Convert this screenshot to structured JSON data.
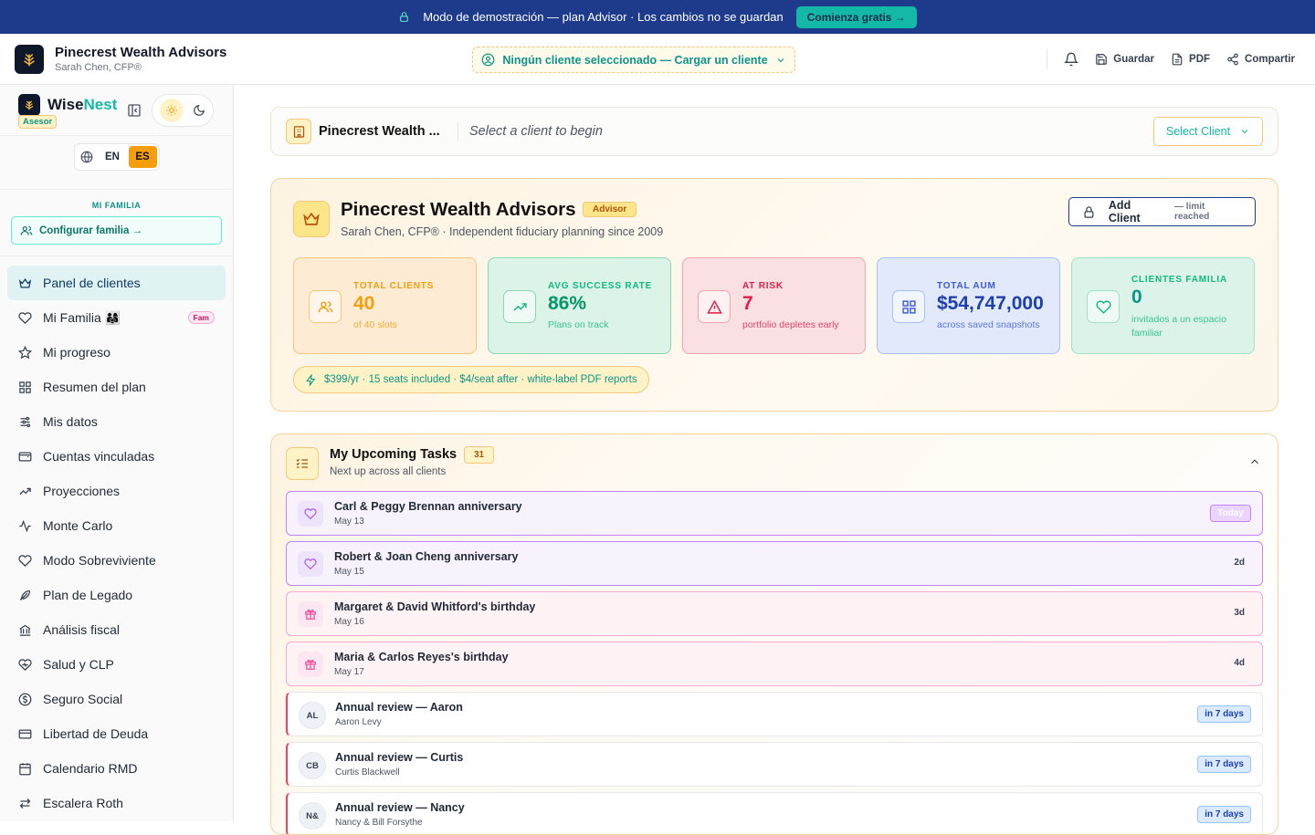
{
  "banner": {
    "text": "Modo de demostración — plan Advisor · Los cambios no se guardan",
    "cta": "Comienza gratis →"
  },
  "header": {
    "firm_name": "Pinecrest Wealth Advisors",
    "advisor": "Sarah Chen, CFP®",
    "client_selector": "Ningún cliente seleccionado — Cargar un cliente",
    "save": "Guardar",
    "pdf": "PDF",
    "share": "Compartir"
  },
  "sidebar": {
    "brand_a": "Wise",
    "brand_b": "Nest",
    "role_badge": "Asesor",
    "lang_en": "EN",
    "lang_es": "ES",
    "family_label": "MI FAMILIA",
    "family_config": "Configurar familia →",
    "fam_badge": "Fam",
    "items": [
      {
        "label": "Panel de clientes",
        "icon": "crown-icon"
      },
      {
        "label": "Mi Familia 👨‍👩‍👧",
        "icon": "heart-icon"
      },
      {
        "label": "Mi progreso",
        "icon": "star-icon"
      },
      {
        "label": "Resumen del plan",
        "icon": "grid-icon"
      },
      {
        "label": "Mis datos",
        "icon": "sliders-icon"
      },
      {
        "label": "Cuentas vinculadas",
        "icon": "wallet-icon"
      },
      {
        "label": "Proyecciones",
        "icon": "trend-icon"
      },
      {
        "label": "Monte Carlo",
        "icon": "pulse-icon"
      },
      {
        "label": "Modo Sobreviviente",
        "icon": "heart-icon"
      },
      {
        "label": "Plan de Legado",
        "icon": "feather-icon"
      },
      {
        "label": "Análisis fiscal",
        "icon": "bank-icon"
      },
      {
        "label": "Salud y CLP",
        "icon": "health-icon"
      },
      {
        "label": "Seguro Social",
        "icon": "dollar-icon"
      },
      {
        "label": "Libertad de Deuda",
        "icon": "card-icon"
      },
      {
        "label": "Calendario RMD",
        "icon": "calendar-icon"
      },
      {
        "label": "Escalera Roth",
        "icon": "swap-icon"
      }
    ]
  },
  "selector": {
    "name": "Pinecrest Wealth ...",
    "placeholder": "Select a client to begin",
    "button": "Select Client"
  },
  "hero": {
    "name": "Pinecrest Wealth Advisors",
    "badge": "Advisor",
    "subtitle": "Sarah Chen, CFP® · Independent fiduciary planning since 2009",
    "add_client": "Add Client",
    "limit": "— limit reached",
    "pricing": "$399/yr · 15 seats included · $4/seat after · white-label PDF reports",
    "stats": [
      {
        "label": "TOTAL CLIENTS",
        "value": "40",
        "note": "of 40 slots",
        "bg": "#fdebd3",
        "border": "#f5c77a",
        "color": "#f59e0b",
        "valcolor": "#f59e0b"
      },
      {
        "label": "AVG SUCCESS RATE",
        "value": "86%",
        "note": "Plans on track",
        "bg": "#dcf3e8",
        "border": "#86d9b0",
        "color": "#10b981",
        "valcolor": "#059669"
      },
      {
        "label": "AT RISK",
        "value": "7",
        "note": "portfolio depletes early",
        "bg": "#fbe0e3",
        "border": "#f5a3ae",
        "color": "#e11d48",
        "valcolor": "#e11d48"
      },
      {
        "label": "TOTAL AUM",
        "value": "$54,747,000",
        "note": "across saved snapshots",
        "bg": "#e1e9fb",
        "border": "#a9c0f4",
        "color": "#3b5bdb",
        "valcolor": "#1e40af"
      },
      {
        "label": "CLIENTES FAMILIA",
        "value": "0",
        "note": "invitados a un espacio familiar",
        "bg": "#dcf3ea",
        "border": "#9fe2c6",
        "color": "#10b981",
        "valcolor": "#0d9488"
      }
    ]
  },
  "tasks": {
    "title": "My Upcoming Tasks",
    "count": "31",
    "subtitle": "Next up across all clients",
    "items": [
      {
        "kind": "love",
        "title": "Carl & Peggy Brennan anniversary",
        "date": "May 13",
        "tag": "Today"
      },
      {
        "kind": "love",
        "title": "Robert & Joan Cheng anniversary",
        "date": "May 15",
        "tag": "2d"
      },
      {
        "kind": "bday",
        "title": "Margaret & David Whitford's birthday",
        "date": "May 16",
        "tag": "3d"
      },
      {
        "kind": "bday",
        "title": "Maria & Carlos Reyes's birthday",
        "date": "May 17",
        "tag": "4d"
      },
      {
        "kind": "rev",
        "initials": "AL",
        "title": "Annual review — Aaron",
        "date": "Aaron Levy",
        "tag": "in 7 days"
      },
      {
        "kind": "rev",
        "initials": "CB",
        "title": "Annual review — Curtis",
        "date": "Curtis Blackwell",
        "tag": "in 7 days"
      },
      {
        "kind": "rev",
        "initials": "N&",
        "title": "Annual review — Nancy",
        "date": "Nancy & Bill Forsythe",
        "tag": "in 7 days"
      }
    ]
  }
}
